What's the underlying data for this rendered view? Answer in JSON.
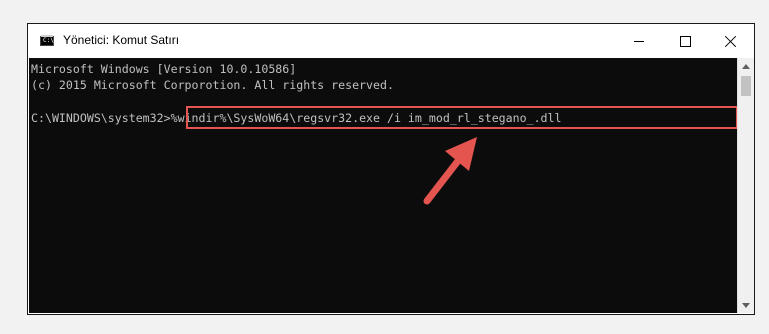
{
  "window": {
    "title": "Yönetici: Komut Satırı",
    "icon": "cmd-icon",
    "controls": {
      "minimize": "minimize-icon",
      "maximize": "maximize-icon",
      "close": "close-icon"
    }
  },
  "console": {
    "lines": [
      "Microsoft Windows [Version 10.0.10586]",
      "(c) 2015 Microsoft Corporotion. All rights reserved."
    ],
    "prompt": "C:\\WINDOWS\\system32>",
    "command": "%windir%\\SysWoW64\\regsvr32.exe /i im_mod_rl_stegano_.dll"
  },
  "annotation": {
    "highlight_color": "#e5554f",
    "arrow_color": "#e5554f"
  }
}
